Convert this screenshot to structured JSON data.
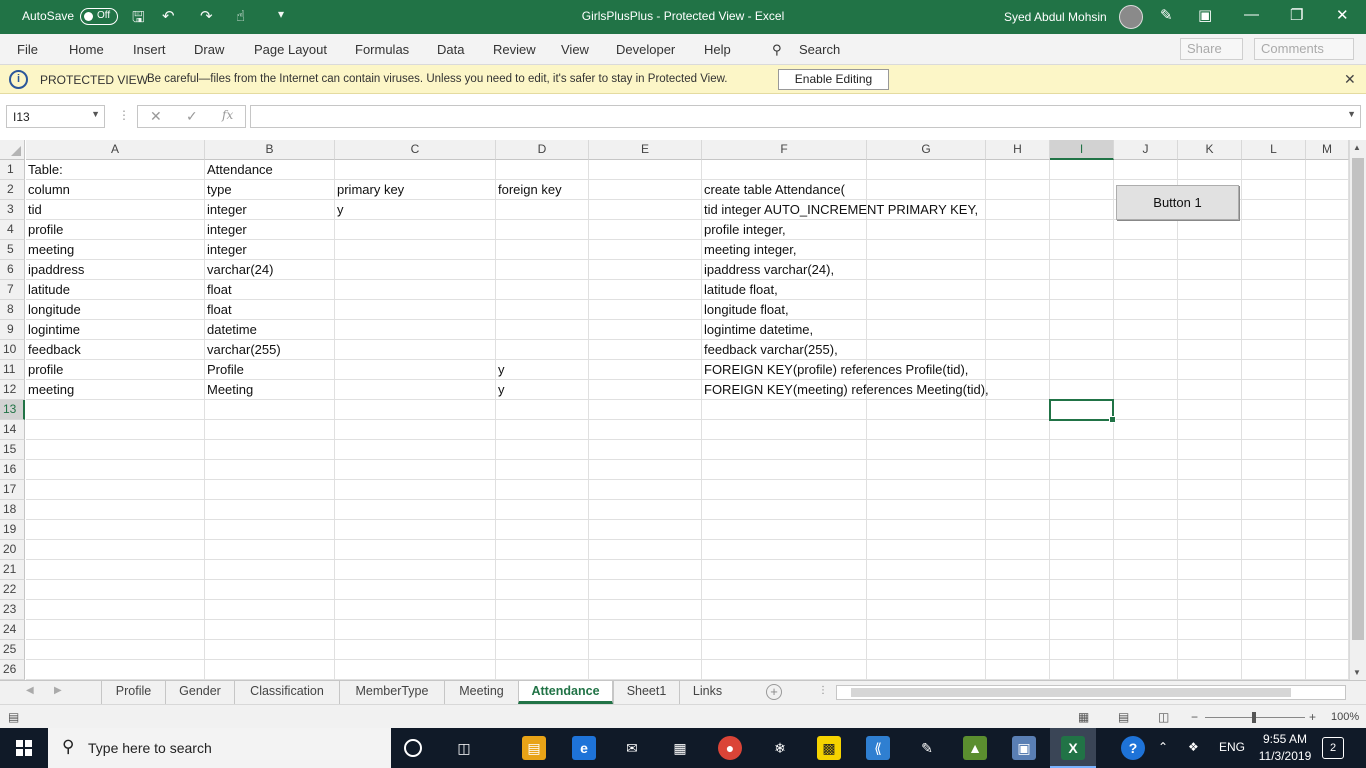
{
  "titlebar": {
    "autosave_label": "AutoSave",
    "autosave_state": "Off",
    "title": "GirlsPlusPlus  -  Protected View  -  Excel",
    "user": "Syed Abdul Mohsin"
  },
  "ribbon": {
    "tabs": [
      "File",
      "Home",
      "Insert",
      "Draw",
      "Page Layout",
      "Formulas",
      "Data",
      "Review",
      "View",
      "Developer",
      "Help"
    ],
    "search": "Search",
    "share": "Share",
    "comments": "Comments"
  },
  "protected_view": {
    "title": "PROTECTED VIEW",
    "message": "Be careful—files from the Internet can contain viruses. Unless you need to edit, it's safer to stay in Protected View.",
    "button": "Enable Editing"
  },
  "formula_bar": {
    "name_box": "I13",
    "fx": "fx",
    "formula": ""
  },
  "sheet": {
    "columns": [
      "A",
      "B",
      "C",
      "D",
      "E",
      "F",
      "G",
      "H",
      "I",
      "J",
      "K",
      "L",
      "M"
    ],
    "rows": [
      "1",
      "2",
      "3",
      "4",
      "5",
      "6",
      "7",
      "8",
      "9",
      "10",
      "11",
      "12",
      "13",
      "14",
      "15",
      "16",
      "17",
      "18",
      "19",
      "20",
      "21",
      "22",
      "23",
      "24",
      "25",
      "26"
    ],
    "cells": [
      [
        "Table:",
        "Attendance",
        "",
        "",
        "",
        ""
      ],
      [
        "column",
        "type",
        "primary key",
        "foreign key",
        "",
        "create table Attendance("
      ],
      [
        "tid",
        "integer",
        "y",
        "",
        "",
        "tid integer AUTO_INCREMENT PRIMARY KEY,"
      ],
      [
        "profile",
        "integer",
        "",
        "",
        "",
        "profile integer,"
      ],
      [
        "meeting",
        "integer",
        "",
        "",
        "",
        "meeting integer,"
      ],
      [
        "ipaddress",
        "varchar(24)",
        "",
        "",
        "",
        "ipaddress varchar(24),"
      ],
      [
        "latitude",
        "float",
        "",
        "",
        "",
        "latitude float,"
      ],
      [
        "longitude",
        "float",
        "",
        "",
        "",
        "longitude float,"
      ],
      [
        "logintime",
        "datetime",
        "",
        "",
        "",
        "logintime datetime,"
      ],
      [
        "feedback",
        "varchar(255)",
        "",
        "",
        "",
        "feedback varchar(255),"
      ],
      [
        "profile",
        "Profile",
        "",
        "y",
        "",
        "FOREIGN KEY(profile) references Profile(tid),"
      ],
      [
        "meeting",
        "Meeting",
        "",
        "y",
        "",
        "FOREIGN KEY(meeting) references Meeting(tid),"
      ]
    ],
    "button1": "Button 1"
  },
  "sheet_tabs": [
    "Profile",
    "Gender",
    "Classification",
    "MemberType",
    "Meeting",
    "Attendance",
    "Sheet1",
    "Links"
  ],
  "active_sheet": "Attendance",
  "status": {
    "zoom": "100%"
  },
  "taskbar": {
    "search_placeholder": "Type here to search",
    "lang": "ENG",
    "time": "9:55 AM",
    "date": "11/3/2019",
    "notifications": "2"
  },
  "colors": {
    "excel_green": "#217346",
    "protected_bar": "#fcf6c7",
    "taskbar": "#101a28"
  }
}
